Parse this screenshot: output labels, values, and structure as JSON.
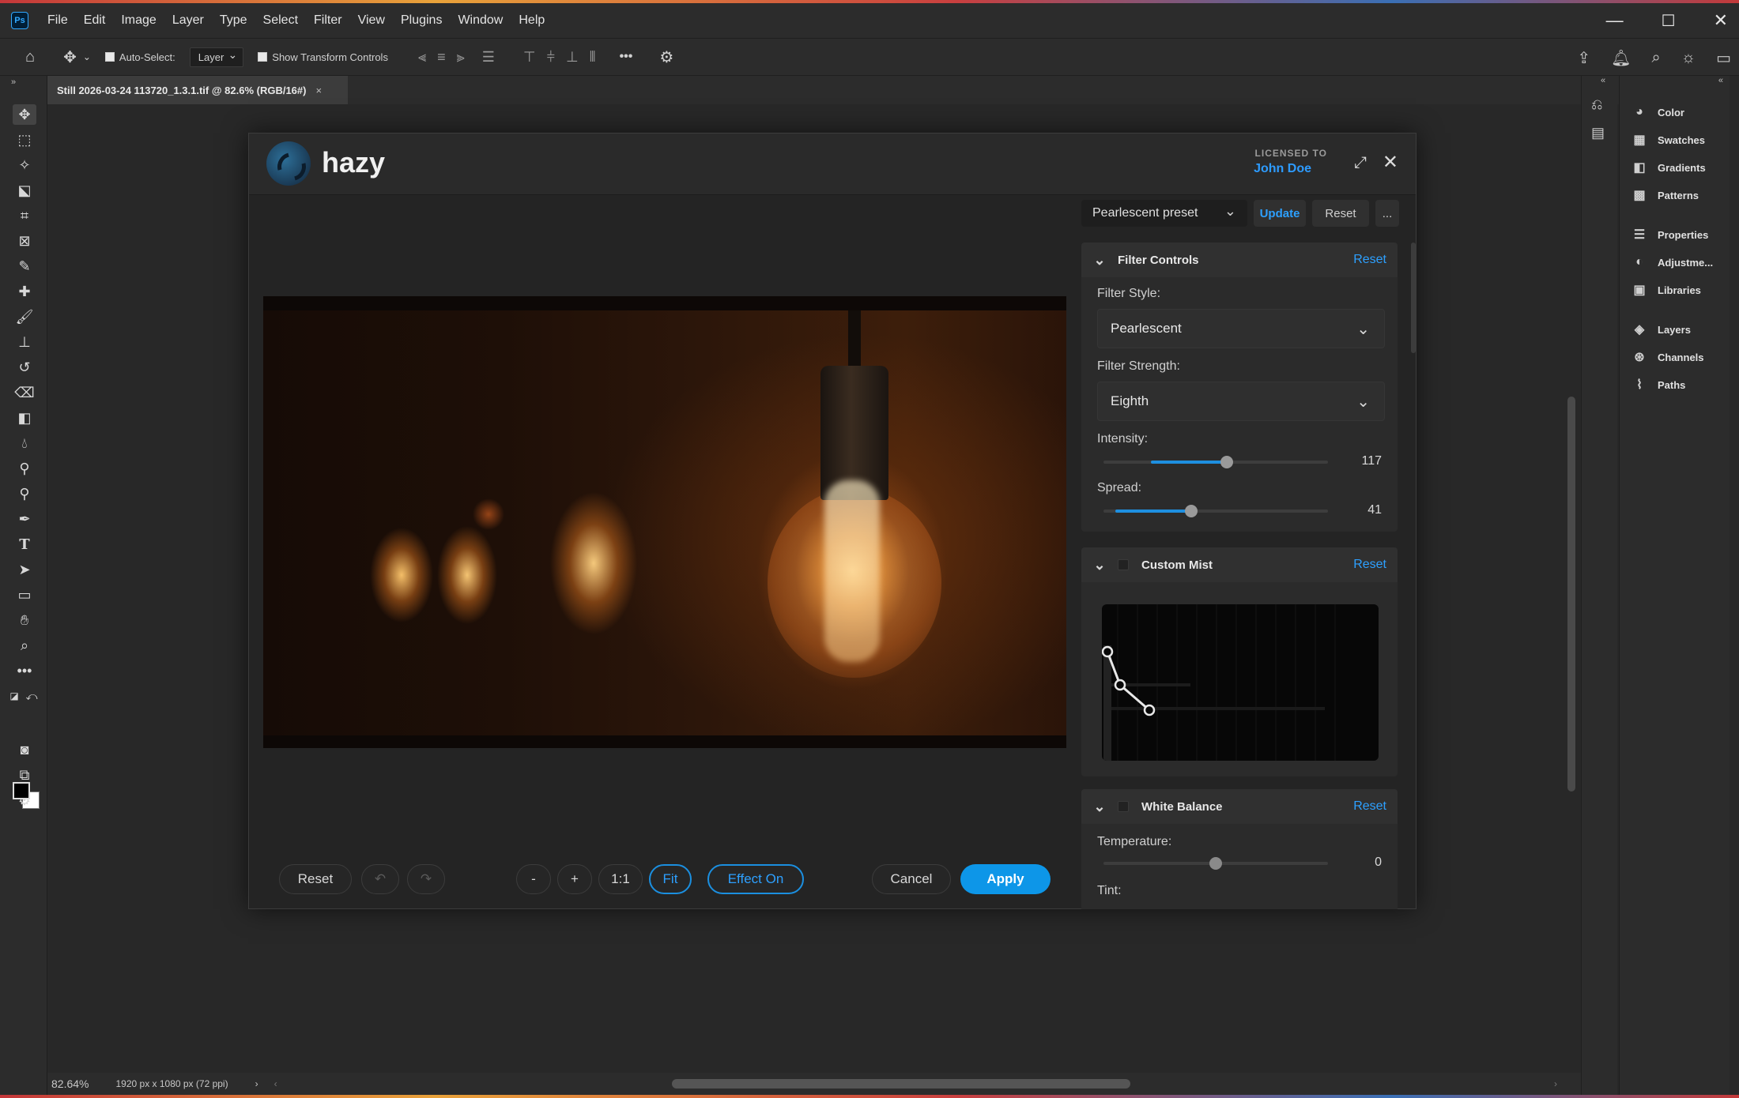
{
  "app": {
    "menu": [
      "File",
      "Edit",
      "Image",
      "Layer",
      "Type",
      "Select",
      "Filter",
      "View",
      "Plugins",
      "Window",
      "Help"
    ],
    "window_controls": [
      "—",
      "☐",
      "✕"
    ],
    "logo_text": "Ps"
  },
  "options_bar": {
    "auto_select_label": "Auto-Select:",
    "auto_select_checked": true,
    "layer_select_value": "Layer",
    "show_transform_label": "Show Transform Controls",
    "show_transform_checked": true,
    "more_label": "•••"
  },
  "document": {
    "tab_title": "Still 2026-03-24 113720_1.3.1.tif @ 82.6% (RGB/16#)",
    "tab_close": "×",
    "zoom": "82.64%",
    "doc_info": "1920 px x 1080 px (72 ppi)"
  },
  "dock": {
    "panels": [
      "Color",
      "Swatches",
      "Gradients",
      "Patterns",
      "Properties",
      "Adjustme...",
      "Libraries",
      "Layers",
      "Channels",
      "Paths"
    ]
  },
  "plugin": {
    "brand": "hazy",
    "licensed_to_label": "LICENSED TO",
    "licensed_to_name": "John Doe",
    "accent_color": "#0d96e8",
    "preset": {
      "value": "Pearlescent preset",
      "update_label": "Update",
      "reset_label": "Reset",
      "more_label": "..."
    },
    "filter_controls": {
      "title": "Filter Controls",
      "reset_label": "Reset",
      "filter_style_label": "Filter Style:",
      "filter_style_value": "Pearlescent",
      "filter_strength_label": "Filter Strength:",
      "filter_strength_value": "Eighth",
      "intensity_label": "Intensity:",
      "intensity_value": "117",
      "intensity_fraction": 0.55,
      "spread_label": "Spread:",
      "spread_value": "41",
      "spread_fraction": 0.39
    },
    "custom_mist": {
      "title": "Custom Mist",
      "reset_label": "Reset"
    },
    "white_balance": {
      "title": "White Balance",
      "reset_label": "Reset",
      "temperature_label": "Temperature:",
      "temperature_value": "0",
      "temperature_fraction": 0.5,
      "tint_label": "Tint:"
    },
    "bottom_bar": {
      "reset_label": "Reset",
      "undo_icon": "↶",
      "redo_icon": "↷",
      "zoom_out_label": "-",
      "zoom_in_label": "+",
      "one_to_one_label": "1:1",
      "fit_label": "Fit",
      "effect_label": "Effect On",
      "cancel_label": "Cancel",
      "apply_label": "Apply"
    }
  }
}
